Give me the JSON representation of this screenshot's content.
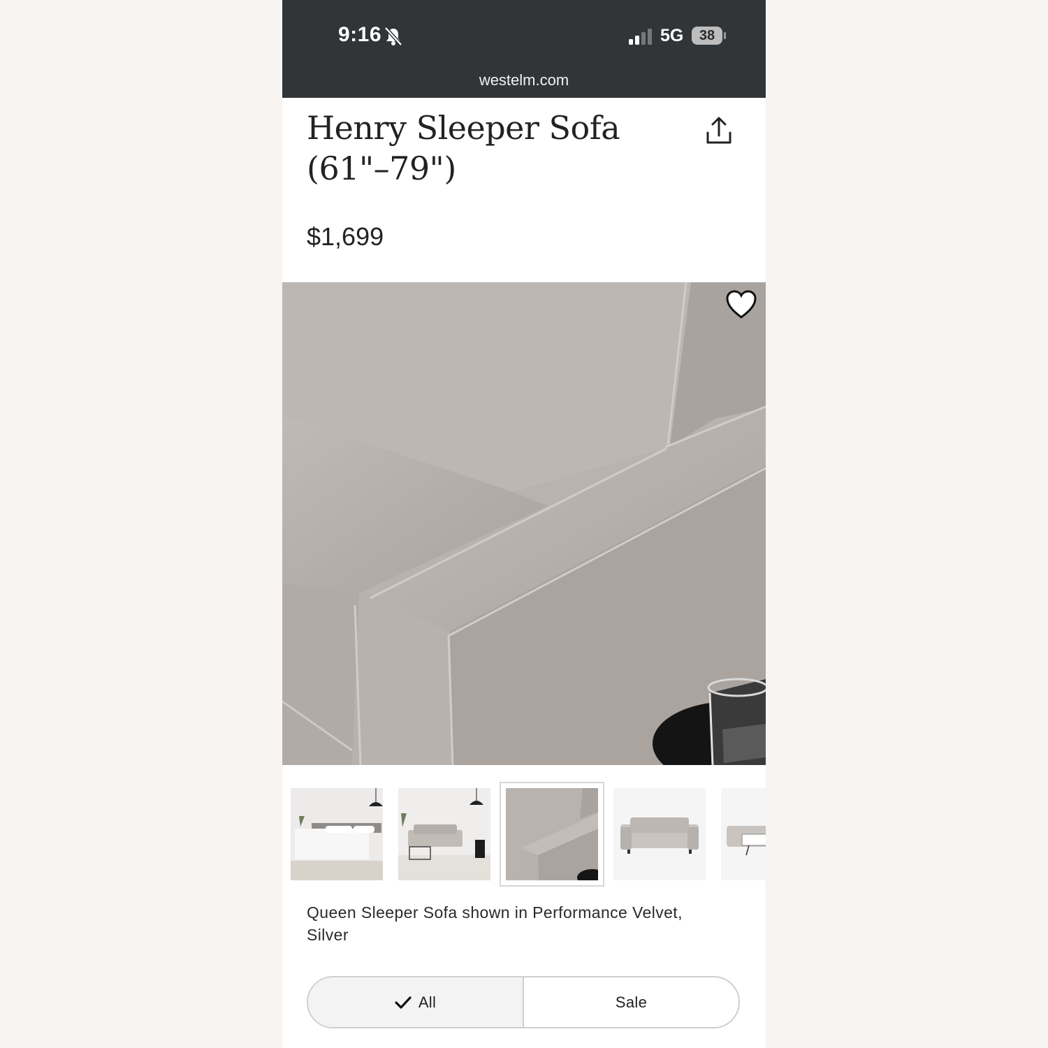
{
  "status_bar": {
    "time": "9:16",
    "network": "5G",
    "battery": "38"
  },
  "browser": {
    "url": "westelm.com"
  },
  "product": {
    "title": "Henry Sleeper Sofa (61\"–79\")",
    "price": "$1,699",
    "caption": "Queen Sleeper Sofa shown in Performance Velvet, Silver"
  },
  "gallery": {
    "selected_index": 2,
    "thumbnail_count": 5
  },
  "filter": {
    "options": [
      "All",
      "Sale"
    ],
    "selected": "All"
  },
  "icons": {
    "mute": "bell-slash-icon",
    "signal": "cellular-signal-icon",
    "share": "share-icon",
    "favorite": "heart-icon",
    "check": "checkmark-icon"
  },
  "colors": {
    "status_bar_bg": "#323538",
    "page_bg": "#f7f4f1",
    "sofa": "#b5afab"
  }
}
